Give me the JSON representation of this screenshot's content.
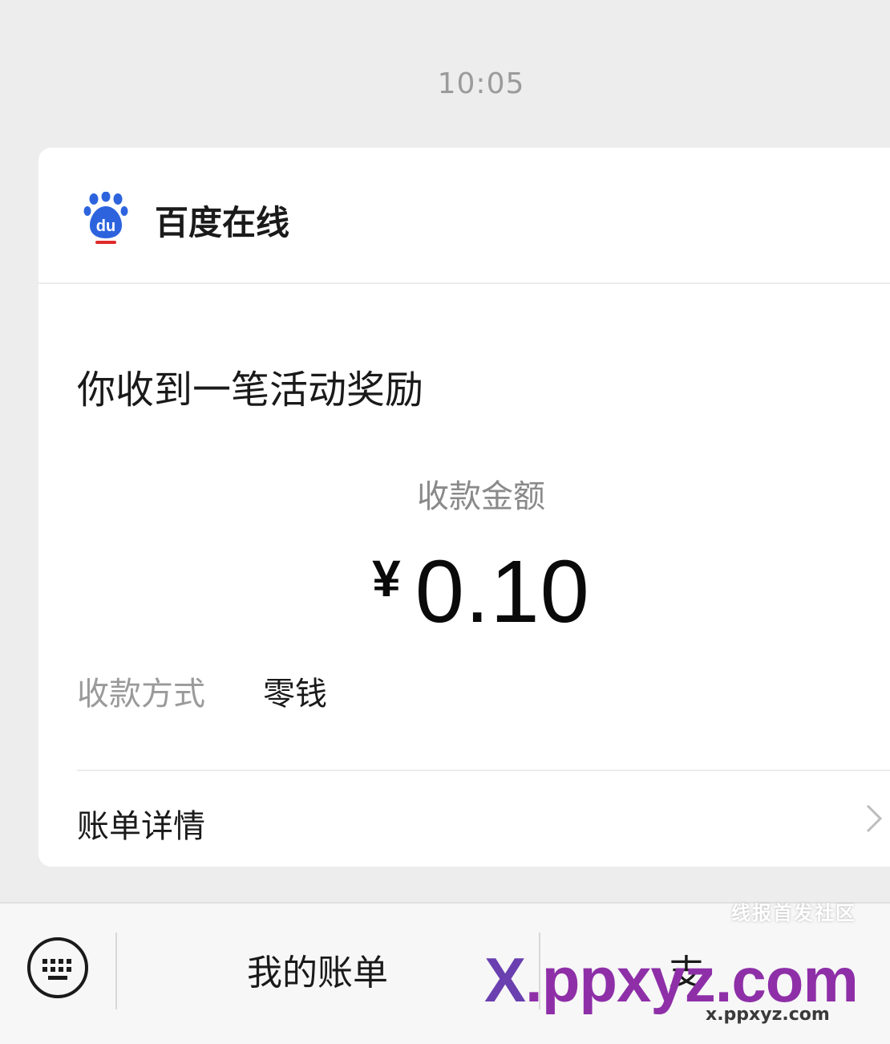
{
  "timestamp": "10:05",
  "card": {
    "sender_name": "百度在线",
    "title": "你收到一笔活动奖励",
    "amount_label": "收款金额",
    "currency_symbol": "¥",
    "amount_value": "0.10",
    "method_label": "收款方式",
    "method_value": "零钱",
    "details_label": "账单详情"
  },
  "bottom_bar": {
    "items": [
      {
        "label": "我的账单"
      },
      {
        "label": "支"
      }
    ]
  },
  "watermark": {
    "main_x": "X",
    "main_rest": ".ppxyz.com",
    "sub": "x.ppxyz.com",
    "tag": "线报首发社区"
  },
  "colors": {
    "background": "#ededed",
    "card": "#ffffff",
    "baidu_blue": "#2d64de",
    "baidu_red": "#e02a2a"
  }
}
